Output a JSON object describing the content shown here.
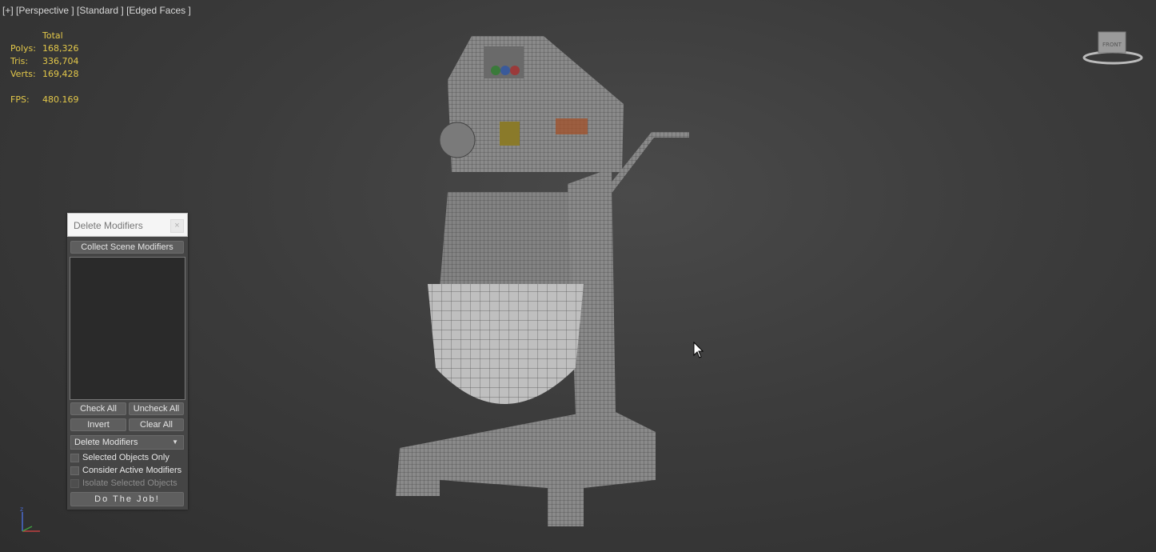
{
  "viewport": {
    "label": "[+] [Perspective ] [Standard ] [Edged Faces ]"
  },
  "stats": {
    "header": "Total",
    "polys_label": "Polys:",
    "polys": "168,326",
    "tris_label": "Tris:",
    "tris": "336,704",
    "verts_label": "Verts:",
    "verts": "169,428",
    "fps_label": "FPS:",
    "fps": "480.169"
  },
  "dialog": {
    "title": "Delete Modifiers",
    "collect_label": "Collect Scene Modifiers",
    "check_all": "Check All",
    "uncheck_all": "Uncheck All",
    "invert": "Invert",
    "clear_all": "Clear All",
    "mode_selected": "Delete Modifiers",
    "opt_selected_only": "Selected Objects Only",
    "opt_consider_active": "Consider Active Modifiers",
    "opt_isolate": "Isolate Selected Objects",
    "do_job": "Do The Job!"
  },
  "colors": {
    "stats_text": "#e3c84a",
    "viewport_bg": "#3c3c3c"
  }
}
